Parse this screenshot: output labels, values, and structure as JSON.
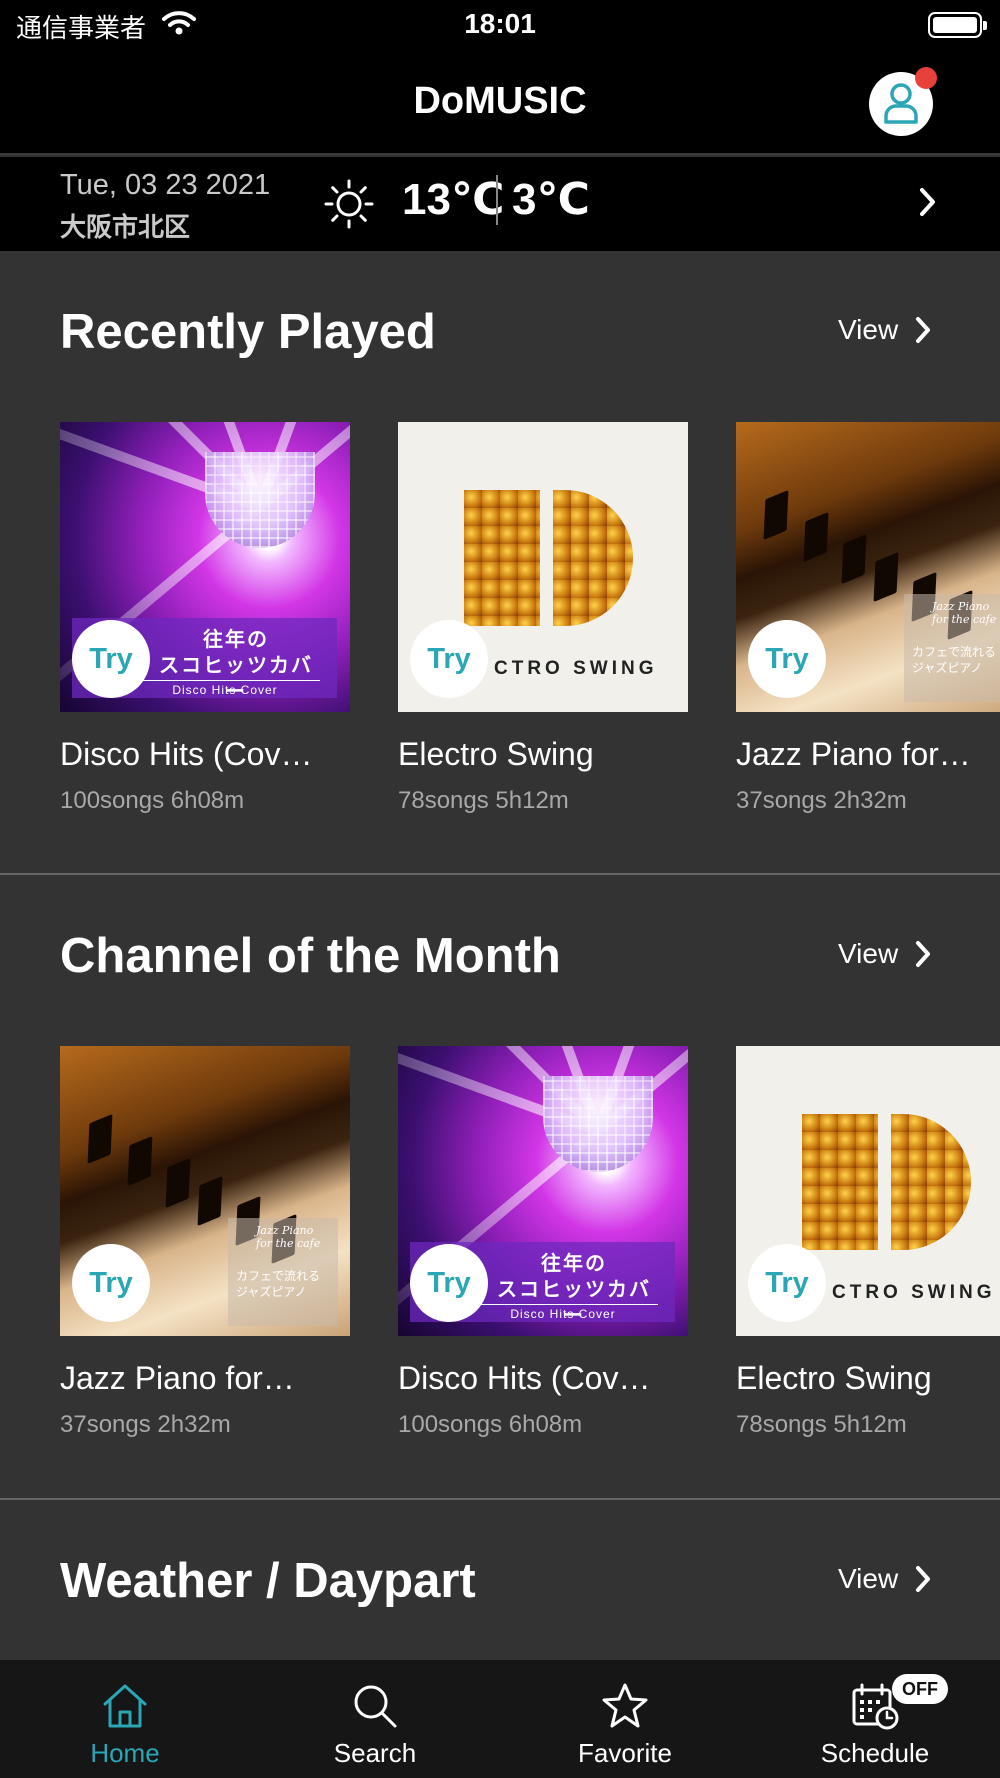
{
  "status_bar": {
    "carrier": "通信事業者",
    "time": "18:01"
  },
  "nav": {
    "title": "DoMUSIC"
  },
  "weather": {
    "date": "Tue, 03 23 2021",
    "location": "大阪市北区",
    "high": "13℃",
    "low": "3℃",
    "icon": "sun-icon"
  },
  "sections": [
    {
      "title": "Recently Played",
      "view_label": "View",
      "cards": [
        {
          "title": "Disco Hits (Cov…",
          "meta": "100songs 6h08m",
          "try": "Try"
        },
        {
          "title": "Electro Swing",
          "meta": "78songs 5h12m",
          "try": "Try"
        },
        {
          "title": "Jazz Piano for…",
          "meta": "37songs 2h32m",
          "try": "Try"
        }
      ]
    },
    {
      "title": "Channel of the Month",
      "view_label": "View",
      "cards": [
        {
          "title": "Jazz Piano for…",
          "meta": "37songs 2h32m",
          "try": "Try"
        },
        {
          "title": "Disco Hits (Cov…",
          "meta": "100songs 6h08m",
          "try": "Try"
        },
        {
          "title": "Electro Swing",
          "meta": "78songs 5h12m",
          "try": "Try"
        }
      ]
    },
    {
      "title": "Weather / Daypart",
      "view_label": "View"
    }
  ],
  "artwork": {
    "disco_jp": "往年の\nスコヒッツカバー",
    "disco_en": "Disco Hits Cover",
    "swing_text": "CTRO SWING",
    "piano_en": "Jazz Piano\nfor the cafe",
    "piano_jp": "カフェで流れる\nジャズピアノ"
  },
  "tabs": [
    {
      "label": "Home",
      "icon": "home-icon",
      "active": true
    },
    {
      "label": "Search",
      "icon": "search-icon"
    },
    {
      "label": "Favorite",
      "icon": "star-icon"
    },
    {
      "label": "Schedule",
      "icon": "calendar-clock-icon",
      "badge": "OFF"
    }
  ],
  "colors": {
    "accent": "#2aa6b5",
    "background": "#333333",
    "bar": "#000000",
    "notification": "#e8403a"
  }
}
